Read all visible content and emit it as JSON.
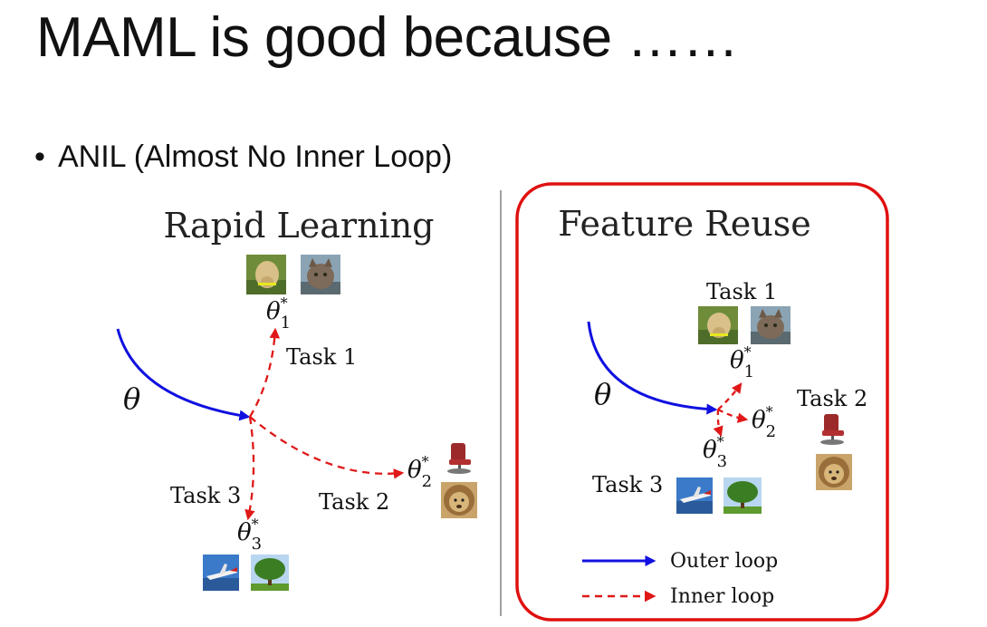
{
  "slide": {
    "title": "MAML is good because ……",
    "bullet": "ANIL (Almost No Inner Loop)"
  },
  "panels": {
    "left": {
      "heading": "Rapid Learning",
      "theta": "θ",
      "tasks": [
        "Task 1",
        "Task 2",
        "Task 3"
      ],
      "optima": [
        {
          "sym": "θ",
          "sub": "1"
        },
        {
          "sym": "θ",
          "sub": "2"
        },
        {
          "sym": "θ",
          "sub": "3"
        }
      ]
    },
    "right": {
      "heading": "Feature Reuse",
      "theta": "θ",
      "tasks": [
        "Task 1",
        "Task 2",
        "Task 3"
      ],
      "optima": [
        {
          "sym": "θ",
          "sub": "1"
        },
        {
          "sym": "θ",
          "sub": "2"
        },
        {
          "sym": "θ",
          "sub": "3"
        }
      ]
    }
  },
  "legend": {
    "outer": "Outer loop",
    "inner": "Inner loop"
  },
  "colors": {
    "outer_loop": "#1010e0",
    "inner_loop": "#e01818",
    "highlight_box": "#e01010",
    "divider": "#a0a0a0"
  },
  "images": {
    "task1": [
      "dog-thumbnail",
      "cat-thumbnail"
    ],
    "task2": [
      "chair-thumbnail",
      "lion-thumbnail"
    ],
    "task3": [
      "airplane-thumbnail",
      "tree-thumbnail"
    ]
  }
}
